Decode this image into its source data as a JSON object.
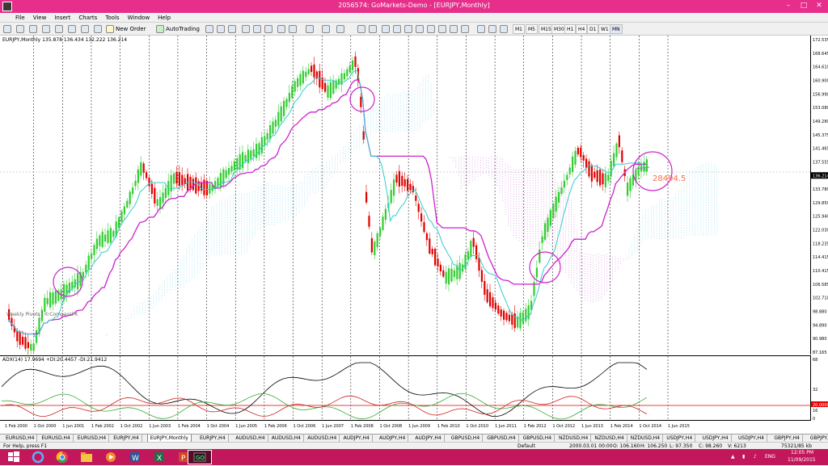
{
  "window": {
    "title": "2056574: GoMarkets-Demo - [EURJPY,Monthly]",
    "minimize": "–",
    "maximize": "□",
    "close": "✕"
  },
  "menu": [
    "File",
    "View",
    "Insert",
    "Charts",
    "Tools",
    "Window",
    "Help"
  ],
  "toolbar": {
    "new_order": "New Order",
    "autotrading": "AutoTrading",
    "timeframes": [
      "M1",
      "M5",
      "M15",
      "M30",
      "H1",
      "H4",
      "D1",
      "W1",
      "MN"
    ]
  },
  "chart": {
    "header": "EURJPY,Monthly  135.878 136.434 132.222 136.214",
    "watermark": "Weekly Pivots | ©CompassFX",
    "price_labels": [
      "172.535",
      "168.645",
      "164.610",
      "160.900",
      "156.990",
      "153.080",
      "149.280",
      "145.375",
      "141.465",
      "137.555",
      "136.214",
      "133.780",
      "129.850",
      "125.940",
      "122.030",
      "118.235",
      "114.415",
      "110.415",
      "106.585",
      "102.710",
      "98.880",
      "94.890",
      "90.980",
      "87.165"
    ],
    "current_price": "136.214",
    "annotation_text": "28494.5",
    "adx_label": "ADX(14) 17.9694 +DI:20.4457 -DI:21.9412",
    "adx_levels": [
      "68",
      "32",
      "20.0000",
      "16",
      "0"
    ],
    "time_labels": [
      "1 Feb 2000",
      "1 Oct 2000",
      "1 Jun 2001",
      "1 Feb 2002",
      "1 Oct 2002",
      "1 Jun 2003",
      "1 Feb 2004",
      "1 Oct 2004",
      "1 Jun 2005",
      "1 Feb 2006",
      "1 Oct 2006",
      "1 Jun 2007",
      "1 Feb 2008",
      "1 Oct 2008",
      "1 Jun 2009",
      "1 Feb 2010",
      "1 Oct 2010",
      "1 Jun 2011",
      "1 Feb 2012",
      "1 Oct 2012",
      "1 Jun 2013",
      "1 Feb 2014",
      "1 Oct 2014",
      "1 Jun 2015"
    ]
  },
  "tabs": [
    "EURUSD,H4",
    "EURUSD,H4",
    "EURUSD,H4",
    "EURJPY,H4",
    "EURJPY,Monthly",
    "EURJPY,H4",
    "AUDUSD,H4",
    "AUDUSD,H4",
    "AUDUSD,H4",
    "AUDJPY,H4",
    "AUDJPY,H4",
    "AUDJPY,H4",
    "GBPUSD,H4",
    "GBPUSD,H4",
    "GBPUSD,H4",
    "NZDUSD,H4",
    "NZDUSD,H4",
    "NZDUSD,H4",
    "USDJPY,H4",
    "USDJPY,H4",
    "USDJPY,H4",
    "GBPJPY,H4",
    "GBPJPY,H4"
  ],
  "active_tab": 4,
  "status": {
    "help": "For Help, press F1",
    "profile": "Default",
    "datetime": "2000.03.01 00:00",
    "open": "O: 106.160",
    "high": "H: 106.250",
    "low": "L: 97.350",
    "close": "C: 98.260",
    "volume": "V: 6213",
    "traffic": "75321/85 kb"
  },
  "taskbar": {
    "lang": "ENG",
    "time": "12:05 PM",
    "date": "11/09/2015"
  },
  "colors": {
    "bull": "#32cd32",
    "bear": "#e00000",
    "kijun": "#cc22cc",
    "tenkan": "#33cccc",
    "adx": "#000000",
    "plus_di": "#33aa33",
    "minus_di": "#cc2222",
    "titlebar": "#e62e8a",
    "taskbar": "#c2185b"
  }
}
